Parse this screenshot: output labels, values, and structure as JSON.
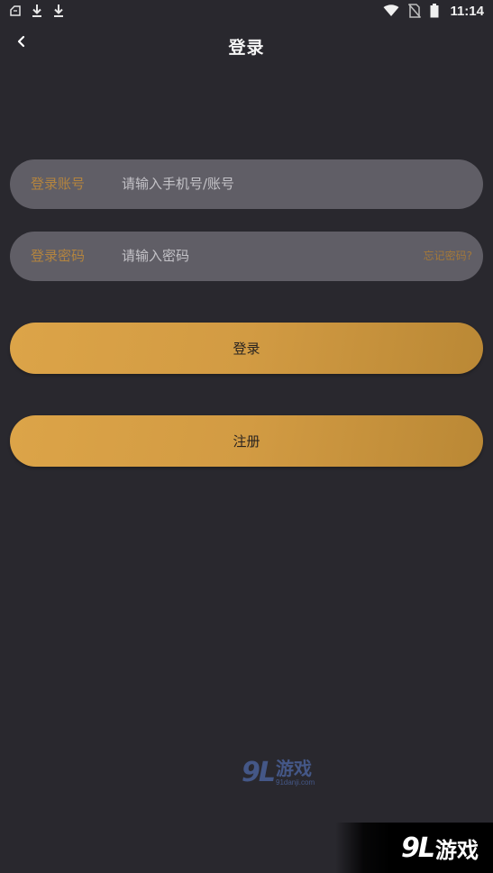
{
  "status_bar": {
    "time": "11:14",
    "left_icons": [
      "notification-icon",
      "download-icon",
      "download-icon"
    ],
    "right_icons": [
      "wifi-icon",
      "no-sim-icon",
      "battery-icon"
    ]
  },
  "header": {
    "title": "登录",
    "back_icon": "chevron-left-icon"
  },
  "form": {
    "account": {
      "label": "登录账号",
      "placeholder": "请输入手机号/账号",
      "value": ""
    },
    "password": {
      "label": "登录密码",
      "placeholder": "请输入密码",
      "value": "",
      "forgot_label": "忘记密码?"
    }
  },
  "buttons": {
    "login_label": "登录",
    "register_label": "注册"
  },
  "watermark": {
    "logo_number": "9L",
    "logo_text": "游戏",
    "url": "91danji.com"
  },
  "colors": {
    "background": "#29282e",
    "field_background": "#605e66",
    "label_gold": "#b3843f",
    "button_gold": "#d29b43"
  }
}
